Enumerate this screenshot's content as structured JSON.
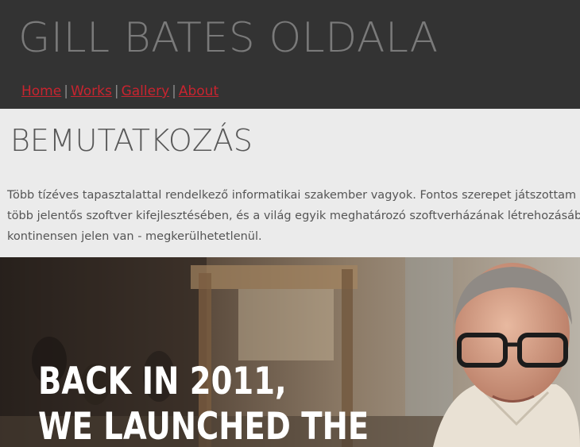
{
  "header": {
    "site_title": "GILL BATES OLDALA",
    "nav": [
      {
        "label": "Home"
      },
      {
        "label": "Works"
      },
      {
        "label": "Gallery"
      },
      {
        "label": "About"
      }
    ],
    "separator": "|"
  },
  "main": {
    "section_title": "BEMUTATKOZÁS",
    "intro_lines": [
      "Több tízéves tapasztalattal rendelkező informatikai szakember vagyok. Fontos szerepet játszottam a m",
      "több jelentős szoftver kifejlesztésében, és a világ egyik meghatározó szoftverházának létrehozásában",
      "kontinensen jelen van - megkerülhetetlenül."
    ]
  },
  "hero": {
    "caption_lines": [
      "BACK IN 2011,",
      "WE LAUNCHED THE"
    ]
  },
  "colors": {
    "header_bg": "#333333",
    "title_text": "#7a7a7a",
    "link": "#c8242f",
    "content_bg": "#ebebeb",
    "body_text": "#555555"
  }
}
